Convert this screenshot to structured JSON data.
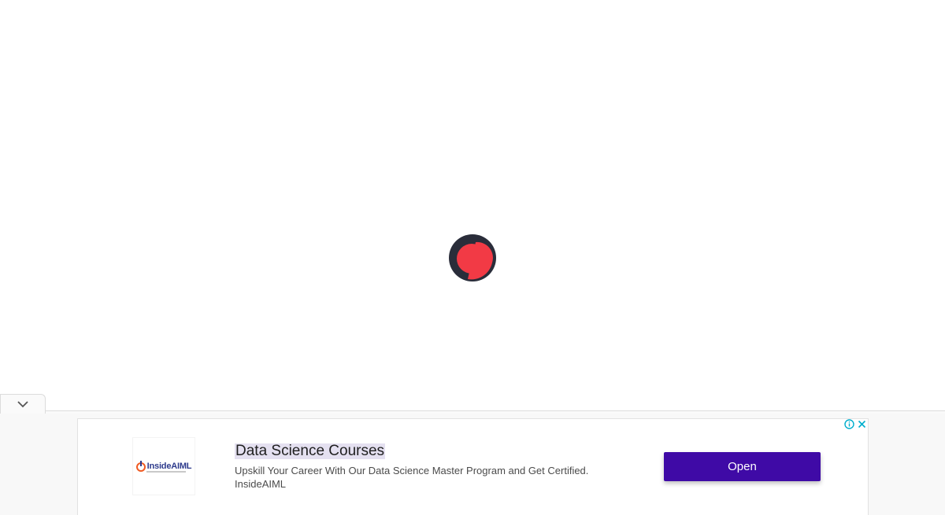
{
  "loader": {
    "colors": {
      "ring": "#2a2d3a",
      "fill": "#f23a45"
    }
  },
  "ad": {
    "logo_text": "InsideAIML",
    "headline": "Data Science Courses",
    "description": "Upskill Your Career With Our Data Science Master Program and Get Certified.",
    "advertiser": "InsideAIML",
    "cta_label": "Open",
    "colors": {
      "cta": "#3f0aa6",
      "badge": "#00aecd"
    }
  }
}
